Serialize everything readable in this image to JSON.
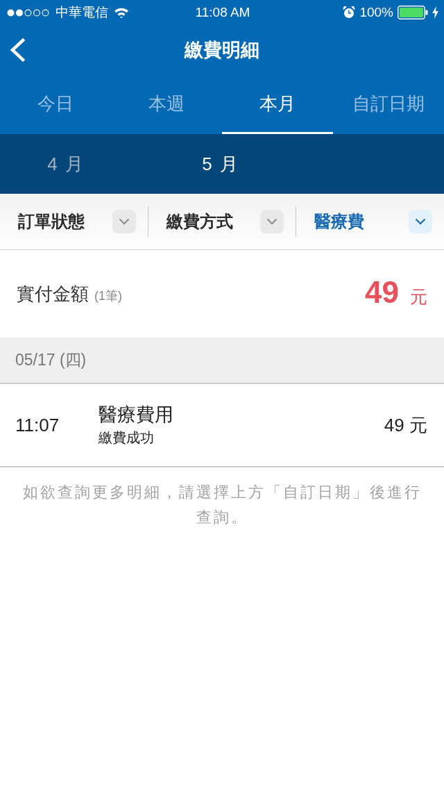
{
  "status_bar": {
    "carrier": "中華電信",
    "time": "11:08 AM",
    "battery": "100%"
  },
  "nav": {
    "title": "繳費明細"
  },
  "tabs": [
    {
      "label": "今日",
      "selected": false
    },
    {
      "label": "本週",
      "selected": false
    },
    {
      "label": "本月",
      "selected": true
    },
    {
      "label": "自訂日期",
      "selected": false
    }
  ],
  "months": [
    {
      "label": "4 月",
      "selected": false
    },
    {
      "label": "5 月",
      "selected": true
    }
  ],
  "filters": [
    {
      "label": "訂單狀態",
      "selected": false
    },
    {
      "label": "繳費方式",
      "selected": false
    },
    {
      "label": "醫療費",
      "selected": true
    }
  ],
  "summary": {
    "label": "實付金額",
    "count": "(1筆)",
    "amount": "49",
    "unit": "元"
  },
  "groups": [
    {
      "date": "05/17 (四)",
      "transactions": [
        {
          "time": "11:07",
          "title": "醫療費用",
          "status": "繳費成功",
          "amount": "49 元"
        }
      ]
    }
  ],
  "footnote": "如欲查詢更多明細，請選擇上方「自訂日期」後進行查詢。"
}
